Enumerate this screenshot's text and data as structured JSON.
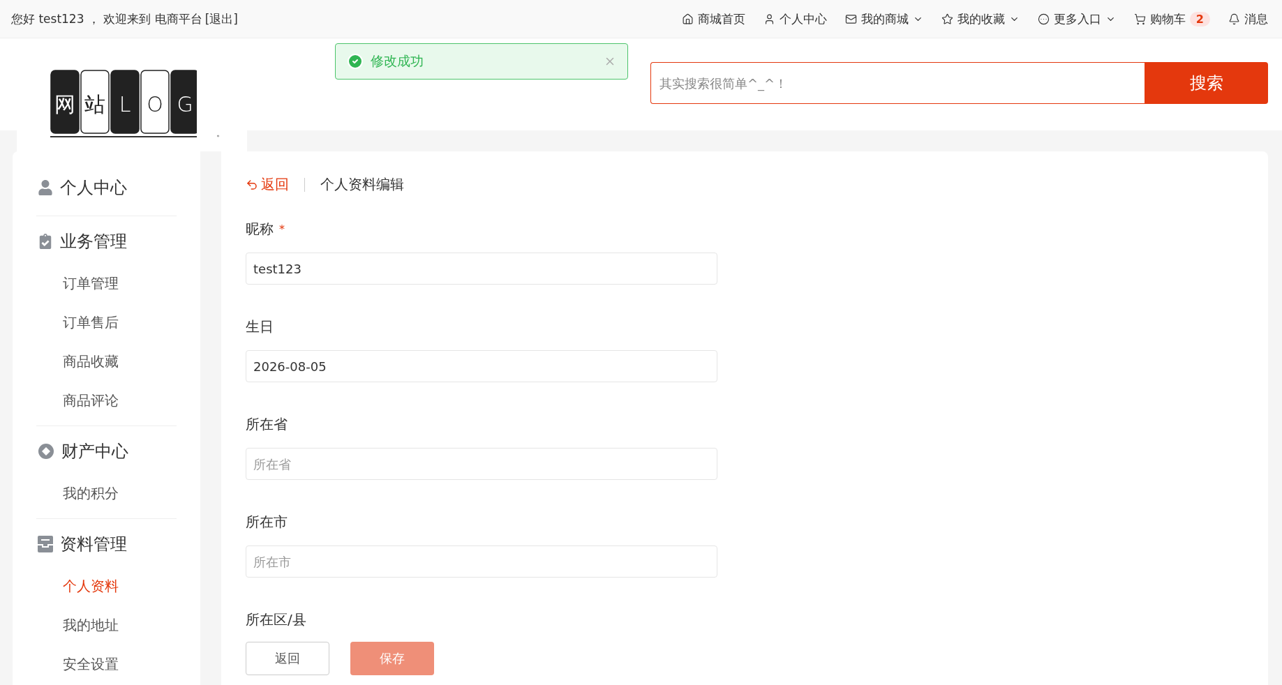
{
  "top_bar": {
    "greeting": "您好 test123 ， 欢迎来到 电商平台",
    "logout": "[退出]",
    "nav": [
      {
        "kind": "home",
        "label": "商城首页",
        "dropdown": false
      },
      {
        "kind": "user",
        "label": "个人中心",
        "dropdown": false
      },
      {
        "kind": "shop",
        "label": "我的商城",
        "dropdown": true
      },
      {
        "kind": "favorites",
        "label": "我的收藏",
        "dropdown": true
      },
      {
        "kind": "more",
        "label": "更多入口",
        "dropdown": true
      },
      {
        "kind": "cart",
        "label": "购物车",
        "dropdown": false,
        "badge": "2"
      },
      {
        "kind": "messages",
        "label": "消息",
        "dropdown": false
      }
    ]
  },
  "toast": {
    "kind": "success",
    "text": "修改成功"
  },
  "logo": {
    "tiles": [
      {
        "char": "网",
        "dark": true
      },
      {
        "char": "站",
        "dark": false
      },
      {
        "char": "L",
        "dark": true
      },
      {
        "char": "O",
        "dark": false
      },
      {
        "char": "G",
        "dark": true
      }
    ],
    "mark": "。"
  },
  "search": {
    "placeholder": "其实搜索很简单^_^！",
    "button": "搜索"
  },
  "sidebar": {
    "groups": [
      {
        "kind": "user",
        "title": "个人中心"
      },
      {
        "kind": "business",
        "title": "业务管理",
        "items": [
          {
            "label": "订单管理",
            "selected": false
          },
          {
            "label": "订单售后",
            "selected": false
          },
          {
            "label": "商品收藏",
            "selected": false
          },
          {
            "label": "商品评论",
            "selected": false
          }
        ]
      },
      {
        "kind": "assets",
        "title": "财产中心",
        "items": [
          {
            "label": "我的积分",
            "selected": false
          }
        ]
      },
      {
        "kind": "profile",
        "title": "资料管理",
        "items": [
          {
            "label": "个人资料",
            "selected": true
          },
          {
            "label": "我的地址",
            "selected": false
          },
          {
            "label": "安全设置",
            "selected": false
          }
        ]
      }
    ]
  },
  "form": {
    "back": "返回",
    "title": "个人资料编辑",
    "fields": [
      {
        "kind": "input",
        "label": "昵称",
        "mark": "*",
        "value": "test123"
      },
      {
        "kind": "input",
        "label": "生日",
        "value": "2026-08-05"
      },
      {
        "kind": "input",
        "label": "所在省",
        "placeholder": "所在省"
      },
      {
        "kind": "input",
        "label": "所在市",
        "placeholder": "所在市"
      },
      {
        "kind": "heading",
        "label": "所在区/县"
      }
    ],
    "buttons": [
      {
        "kind": "secondary",
        "label": "返回"
      },
      {
        "kind": "primary",
        "label": "保存",
        "disabled": true
      }
    ]
  }
}
